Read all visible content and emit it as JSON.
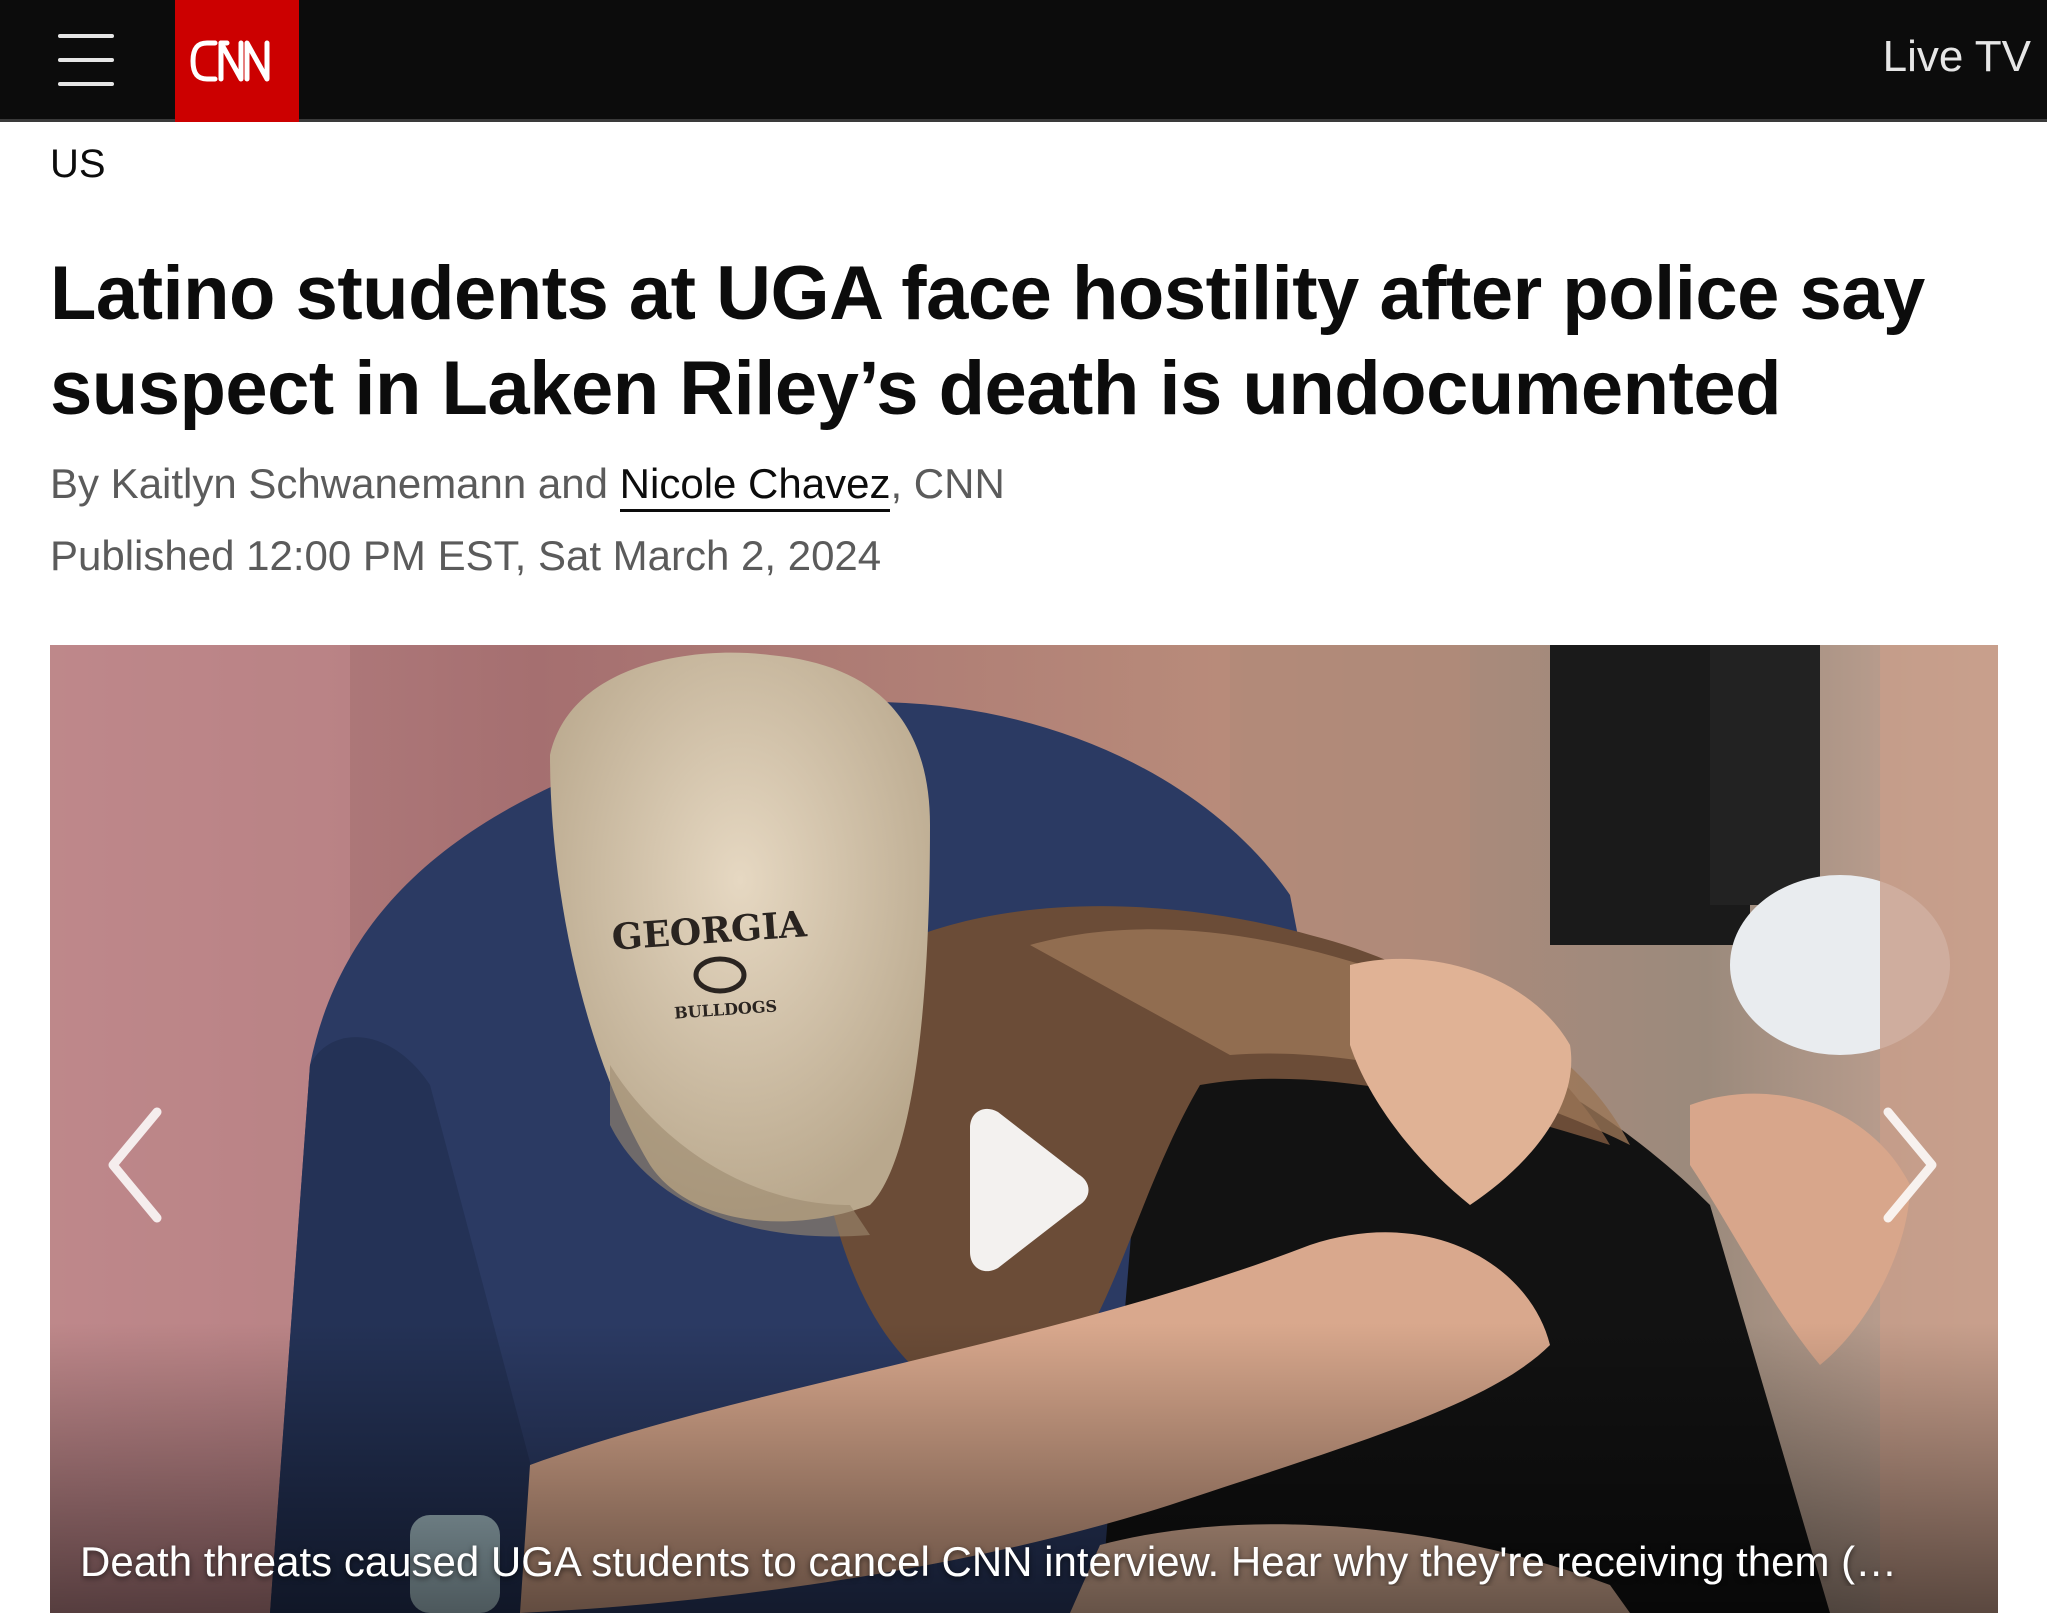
{
  "header": {
    "menu_icon": "hamburger-menu-icon",
    "logo_text": "CNN",
    "live_tv_label": "Live TV"
  },
  "section": {
    "label": "US"
  },
  "article": {
    "headline": "Latino students at UGA face hostility after police say suspect in Laken Riley’s death is undocumented",
    "byline_prefix": "By Kaitlyn Schwanemann and ",
    "byline_link": "Nicole Chavez",
    "byline_suffix": ", CNN",
    "published": "Published 12:00 PM EST, Sat March 2, 2024"
  },
  "media": {
    "cap_text": "GEORGIA",
    "cap_sub": "BULLDOGS",
    "caption": "Death threats caused UGA students to cancel CNN interview. Hear why they're receiving them (…",
    "play_icon": "play-icon",
    "prev_icon": "chevron-left-icon",
    "next_icon": "chevron-right-icon"
  },
  "colors": {
    "brand_red": "#cc0000",
    "topbar_bg": "#0c0c0c",
    "text_primary": "#0c0c0c",
    "text_secondary": "#5b5b5b"
  }
}
